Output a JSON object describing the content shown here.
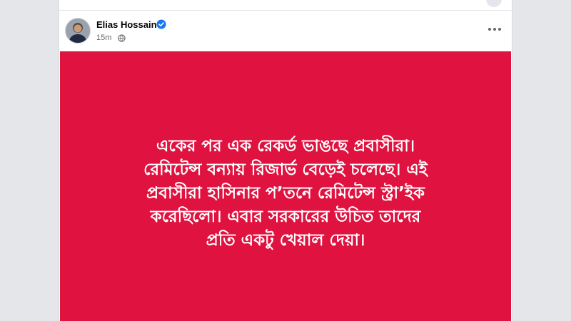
{
  "post": {
    "author": "Elias Hossain",
    "time": "15m",
    "privacy_icon": "globe-icon",
    "verified_icon": "verified-badge-icon",
    "more_icon": "more-options-icon",
    "background_color": "#e0123f",
    "text_lines": [
      "একের পর এক রেকর্ড ভাঙছে প্রবাসীরা।",
      "রেমিটেন্স বন্যায় রিজার্ভ বেড়েই চলেছে। এই",
      "প্রবাসীরা হাসিনার প’তনে রেমিটেন্স স্ট্রা’ইক",
      "করেছিলো। এবার সরকারের উচিত তাদের",
      "প্রতি একটু খেয়াল দেয়া।"
    ]
  }
}
